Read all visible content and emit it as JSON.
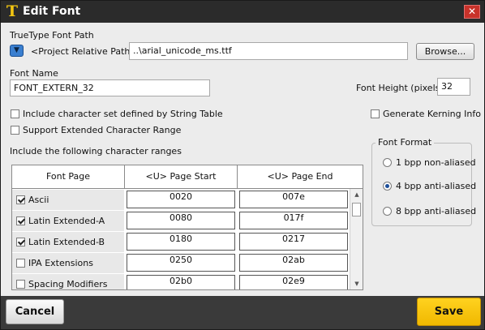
{
  "window": {
    "title": "Edit Font",
    "app_icon": "T",
    "close_icon": "✕"
  },
  "font_path": {
    "label": "TrueType Font Path",
    "path_type": "<Project Relative Path>",
    "value": "..\\arial_unicode_ms.ttf",
    "browse_label": "Browse..."
  },
  "font_name": {
    "label": "Font Name",
    "value": "FONT_EXTERN_32"
  },
  "font_height": {
    "label": "Font Height (pixels)",
    "value": "32"
  },
  "options": {
    "include_string_table": {
      "label": "Include character set defined by String Table",
      "checked": false
    },
    "extended_range": {
      "label": "Support Extended Character Range",
      "checked": false
    },
    "kerning": {
      "label": "Generate Kerning Info",
      "checked": false
    }
  },
  "ranges": {
    "label": "Include the following character ranges",
    "columns": [
      "Font Page",
      "<U> Page Start",
      "<U> Page End"
    ],
    "rows": [
      {
        "name": "Ascii",
        "start": "0020",
        "end": "007e",
        "checked": true
      },
      {
        "name": "Latin Extended-A",
        "start": "0080",
        "end": "017f",
        "checked": true
      },
      {
        "name": "Latin Extended-B",
        "start": "0180",
        "end": "0217",
        "checked": true
      },
      {
        "name": "IPA Extensions",
        "start": "0250",
        "end": "02ab",
        "checked": false
      },
      {
        "name": "Spacing Modifiers",
        "start": "02b0",
        "end": "02e9",
        "checked": false
      }
    ]
  },
  "font_format": {
    "label": "Font Format",
    "options": [
      {
        "label": "1 bpp non-aliased",
        "selected": false
      },
      {
        "label": "4 bpp anti-aliased",
        "selected": true
      },
      {
        "label": "8 bpp anti-aliased",
        "selected": false
      }
    ]
  },
  "footer": {
    "cancel_label": "Cancel",
    "save_label": "Save"
  },
  "colors": {
    "titlebar": "#2b2b2b",
    "close": "#c8322a",
    "save": "#f5c400",
    "accent": "#3a7fd0"
  }
}
